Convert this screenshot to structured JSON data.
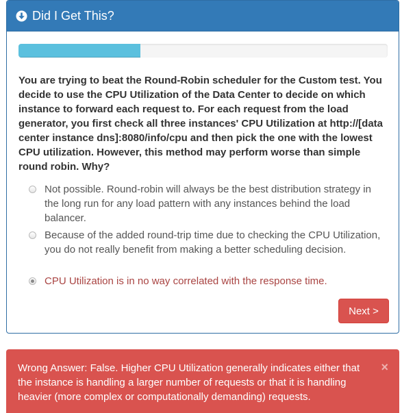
{
  "panel": {
    "title": "Did I Get This?",
    "title_icon": "circle-arrow-down-icon"
  },
  "progress": {
    "value_fraction": 0.33
  },
  "question": {
    "text": "You are trying to beat the Round-Robin scheduler for the Custom test. You decide to use the CPU Utilization of the Data Center to decide on which instance to forward each request to. For each request from the load generator, you first check all three instances' CPU Utilization at http://[data center instance dns]:8080/info/cpu and then pick the one with the lowest CPU utilization. However, this method may perform worse than simple round robin. Why?"
  },
  "options": [
    {
      "label": "Not possible. Round-robin will always be the best distribution strategy in the long run for any load pattern with any instances behind the load balancer.",
      "selected": false
    },
    {
      "label": "Because of the added round-trip time due to checking the CPU Utilization, you do not really benefit from making a better scheduling decision.",
      "selected": false
    },
    {
      "label": "CPU Utilization is in no way correlated with the response time.",
      "selected": true
    }
  ],
  "next_button": {
    "label": "Next >"
  },
  "feedback": {
    "text": "Wrong Answer: False. Higher CPU Utilization generally indicates either that the instance is handling a larger number of requests or that it is handling heavier (more complex or computationally demanding) requests.",
    "close_label": "×"
  },
  "colors": {
    "primary": "#337ab7",
    "progress": "#5bc0de",
    "danger": "#d9534f",
    "selected_text": "#a94442"
  }
}
